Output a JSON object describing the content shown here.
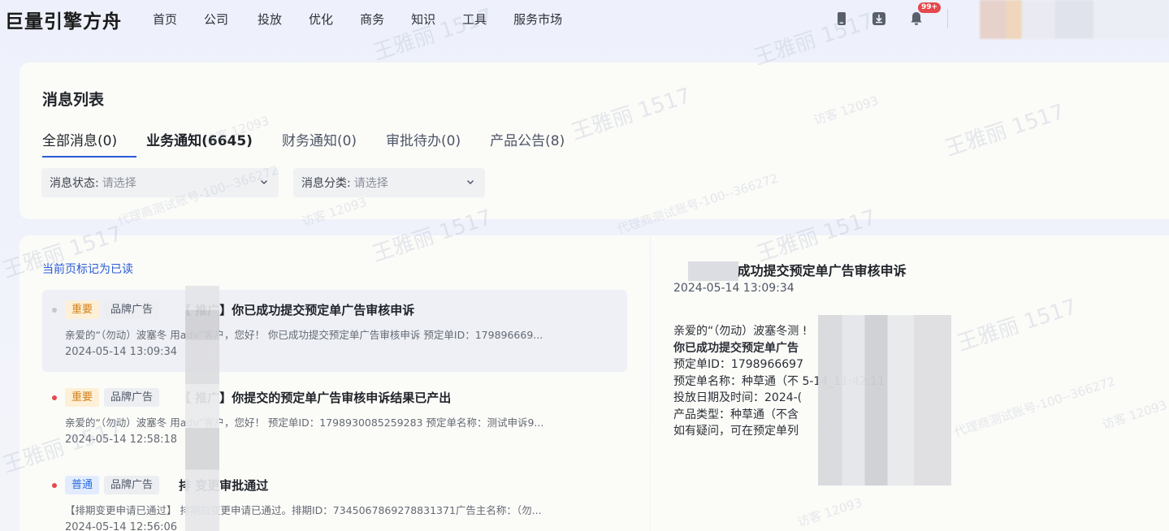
{
  "app": {
    "logo_text": "巨量引擎方舟"
  },
  "nav": {
    "items": [
      "首页",
      "公司",
      "投放",
      "优化",
      "商务",
      "知识",
      "工具",
      "服务市场"
    ]
  },
  "topbar": {
    "icons": [
      "phone-icon",
      "download-icon",
      "bell-icon"
    ],
    "notification_badge": "99+"
  },
  "page": {
    "title": "消息列表",
    "tabs": [
      {
        "label": "全部消息(0)",
        "active": true
      },
      {
        "label": "业务通知(6645)",
        "active": false
      },
      {
        "label": "财务通知(0)",
        "active": false
      },
      {
        "label": "审批待办(0)",
        "active": false
      },
      {
        "label": "产品公告(8)",
        "active": false
      }
    ],
    "filters": [
      {
        "label": "消息状态:",
        "placeholder": "请选择"
      },
      {
        "label": "消息分类:",
        "placeholder": "请选择"
      }
    ]
  },
  "list": {
    "mark_read_label": "当前页标记为已读",
    "messages": [
      {
        "priority": "重要",
        "category": "品牌广告",
        "title": "【 推广】你已成功提交预定单广告审核申诉",
        "desc": "亲爱的“（勿动）波塞冬 用adv”客户，您好！ 你已成功提交预定单广告审核申诉 预定单ID：179896669...",
        "time": "2024-05-14 13:09:34",
        "read": true
      },
      {
        "priority": "重要",
        "category": "品牌广告",
        "title": "【 推广】你提交的预定单广告审核申诉结果已产出",
        "desc": "亲爱的“（勿动）波塞冬 用adv”客户，您好！ 预定单ID：1798930085259283 预定单名称：测试申诉9...",
        "time": "2024-05-14 12:58:18",
        "read": false
      },
      {
        "priority": "普通",
        "category": "品牌广告",
        "title": "排 变更审批通过",
        "desc": "【排期变更申请已通过】 排期的变更申请已通过。排期ID：7345067869278831371广告主名称：（勿...",
        "time": "2024-05-14 12:56:06",
        "read": false
      }
    ]
  },
  "detail": {
    "title": "【 】你已成功提交预定单广告审核申诉",
    "time": "2024-05-14 13:09:34",
    "lines": [
      "亲爱的“（勿动）波塞冬测 !",
      "你已成功提交预定单广告",
      "预定单ID：1798966697",
      "预定单名称：种草通（不 5-14_11:42:11",
      "投放日期及时间：2024-(",
      "产品类型：种草通（不含",
      "如有疑问，可在预定单列"
    ]
  },
  "watermark": {
    "name": "王雅丽 1517",
    "visitor": "访客 12093",
    "account": "代理商测试账号-100--366272"
  },
  "colors": {
    "accent": "#2a5bd7",
    "important_tag": "#d4801a",
    "normal_tag": "#2a6de0",
    "unread_dot": "#e5484d"
  }
}
